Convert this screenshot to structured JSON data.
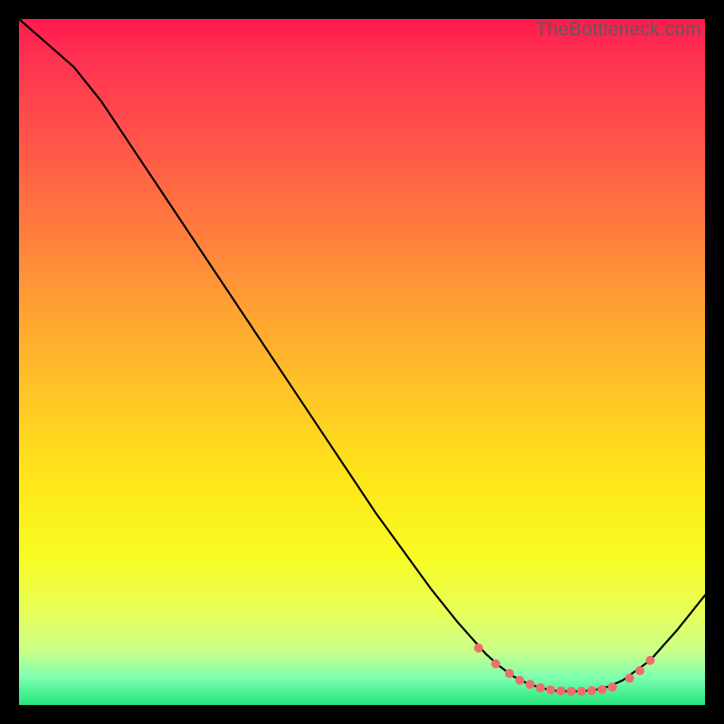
{
  "watermark": "TheBottleneck.com",
  "chart_data": {
    "type": "line",
    "title": "",
    "xlabel": "",
    "ylabel": "",
    "xlim": [
      0,
      100
    ],
    "ylim": [
      0,
      100
    ],
    "grid": false,
    "legend": false,
    "series": [
      {
        "name": "curve",
        "color": "#000000",
        "x": [
          0,
          4,
          8,
          12,
          16,
          20,
          24,
          28,
          32,
          36,
          40,
          44,
          48,
          52,
          56,
          60,
          64,
          68,
          70,
          72,
          74,
          76,
          78,
          80,
          82,
          84,
          86,
          88,
          92,
          96,
          100
        ],
        "y": [
          100,
          96.5,
          93,
          88,
          82,
          76,
          70,
          64,
          58,
          52,
          46,
          40,
          34,
          28,
          22.5,
          17,
          12,
          7.5,
          5.7,
          4.2,
          3.2,
          2.5,
          2.1,
          2.0,
          2.0,
          2.2,
          2.7,
          3.6,
          6.5,
          11,
          16
        ]
      }
    ],
    "markers": {
      "name": "bottom-markers",
      "color": "#ef6d6d",
      "radius": 5,
      "x": [
        67,
        69.5,
        71.5,
        73,
        74.5,
        76,
        77.5,
        79,
        80.5,
        82,
        83.5,
        85,
        86.5,
        89,
        90.5,
        92
      ],
      "y": [
        8.3,
        6.0,
        4.6,
        3.6,
        3.0,
        2.5,
        2.2,
        2.05,
        2.0,
        2.0,
        2.1,
        2.25,
        2.6,
        3.9,
        5.0,
        6.5
      ]
    },
    "colors": {
      "gradient_top": "#ff1a4d",
      "gradient_bottom": "#22e57a",
      "background": "#000000",
      "line": "#000000",
      "marker": "#ef6d6d"
    }
  }
}
